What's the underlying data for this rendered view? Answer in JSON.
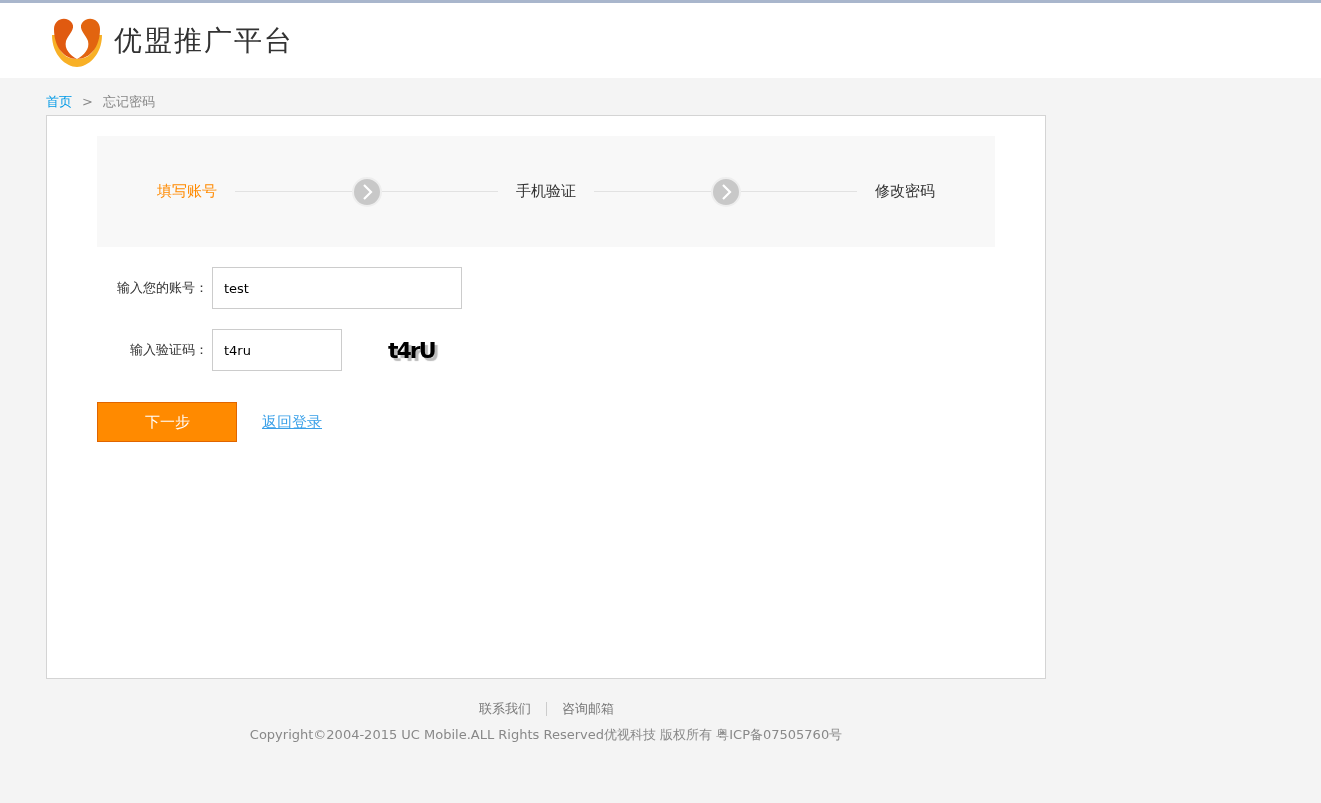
{
  "header": {
    "logo_text": "优盟推广平台"
  },
  "breadcrumb": [
    {
      "label": "首页",
      "link": true
    },
    {
      "label": ">",
      "link": false
    },
    {
      "label": "忘记密码",
      "link": false
    }
  ],
  "steps": [
    {
      "label": "填写账号",
      "selected": true
    },
    {
      "label": "手机验证",
      "selected": false
    },
    {
      "label": "修改密码",
      "selected": false
    }
  ],
  "form": {
    "account_label": "输入您的账号：",
    "account_value": "test",
    "captcha_label": "输入验证码：",
    "captcha_value": "t4ru",
    "captcha_image_text": "t4rU"
  },
  "next_button": "下一步",
  "back_link": "返回登录",
  "footer": {
    "links": [
      "联系我们",
      "咨询邮箱"
    ],
    "copyright": "Copyright©2004-2015 UC Mobile.ALL Rights Reserved优视科技 版权所有 粤ICP备07505760号"
  }
}
